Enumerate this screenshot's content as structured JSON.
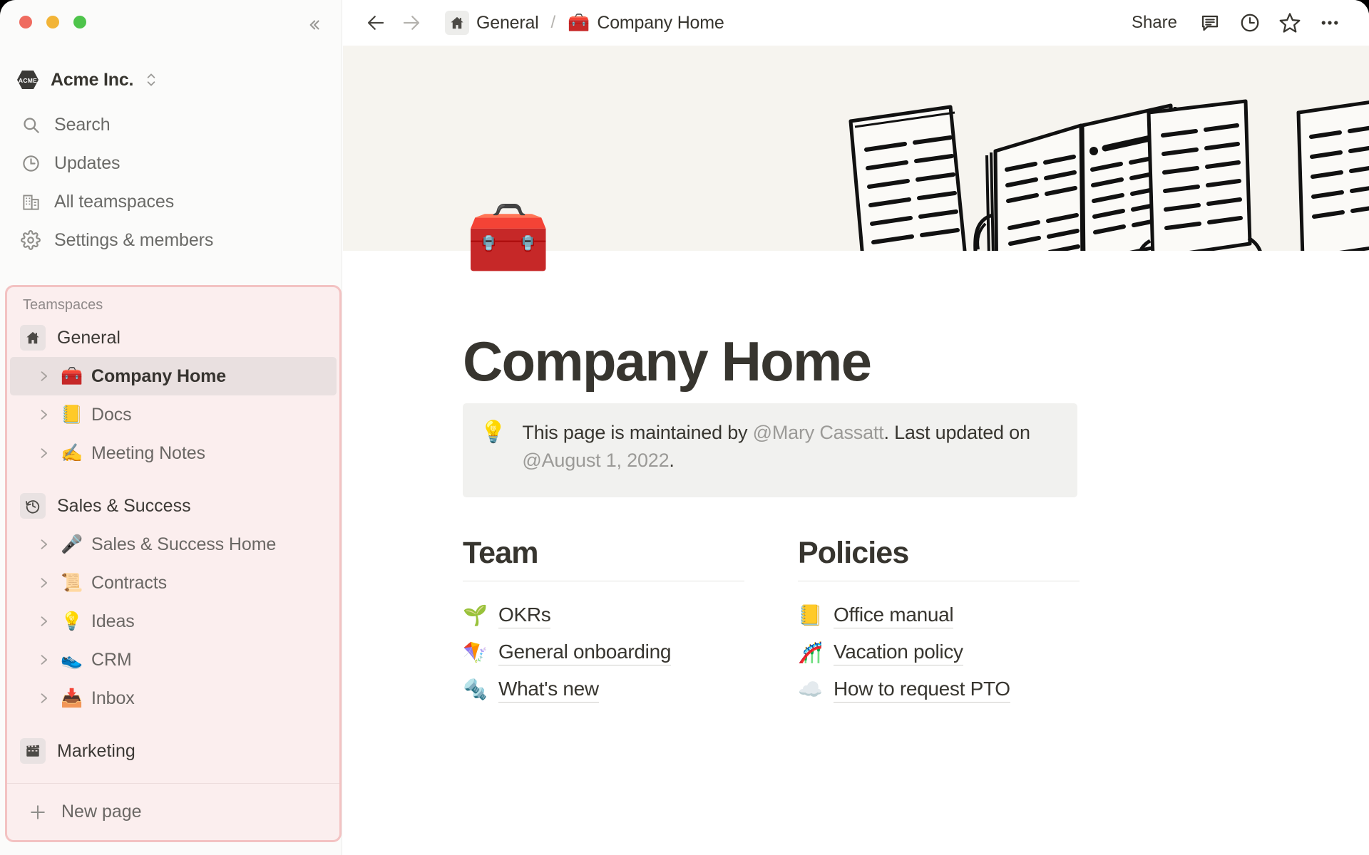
{
  "window": {
    "traffic_lights": [
      "close",
      "minimize",
      "maximize"
    ],
    "collapse_label": "«"
  },
  "sidebar": {
    "workspace": {
      "name": "Acme Inc.",
      "logo_text": "ACME",
      "switcher_icon": "chevron-up-down-icon"
    },
    "nav": [
      {
        "label": "Search",
        "icon": "search-icon"
      },
      {
        "label": "Updates",
        "icon": "clock-icon"
      },
      {
        "label": "All teamspaces",
        "icon": "building-icon"
      },
      {
        "label": "Settings & members",
        "icon": "gear-icon"
      }
    ],
    "teamspaces": {
      "title": "Teamspaces",
      "highlight_border_color": "#f3c2c2",
      "highlight_bg_color": "#fbeeee",
      "groups": [
        {
          "name": "General",
          "icon": "home-icon",
          "pages": [
            {
              "label": "Company Home",
              "emoji": "🧰",
              "selected": true
            },
            {
              "label": "Docs",
              "emoji": "📒",
              "selected": false
            },
            {
              "label": "Meeting Notes",
              "emoji": "✍️",
              "selected": false
            }
          ]
        },
        {
          "name": "Sales & Success",
          "icon": "history-icon",
          "pages": [
            {
              "label": "Sales & Success Home",
              "emoji": "🎤",
              "selected": false
            },
            {
              "label": "Contracts",
              "emoji": "📜",
              "selected": false
            },
            {
              "label": "Ideas",
              "emoji": "💡",
              "selected": false
            },
            {
              "label": "CRM",
              "emoji": "👟",
              "selected": false
            },
            {
              "label": "Inbox",
              "emoji": "📥",
              "selected": false
            }
          ]
        },
        {
          "name": "Marketing",
          "icon": "clapperboard-icon",
          "pages": []
        }
      ]
    },
    "new_page": {
      "label": "New page",
      "icon": "plus-icon"
    }
  },
  "topbar": {
    "back_icon": "arrow-left-icon",
    "forward_icon": "arrow-right-icon",
    "breadcrumb": {
      "separator": "/",
      "items": [
        {
          "label": "General",
          "icon": "home-icon",
          "emoji": ""
        },
        {
          "label": "Company Home",
          "icon": "",
          "emoji": "🧰"
        }
      ]
    },
    "share_label": "Share",
    "actions": [
      {
        "name": "comment-icon"
      },
      {
        "name": "history-icon"
      },
      {
        "name": "star-icon"
      },
      {
        "name": "more-icon"
      }
    ]
  },
  "page": {
    "cover_bg": "#f6f4ef",
    "icon_emoji": "🧰",
    "title": "Company Home",
    "callout": {
      "emoji": "💡",
      "prefix": "This page is maintained by ",
      "mention_user": "@Mary Cassatt",
      "middle": ". Last updated on ",
      "mention_date": "@August 1, 2022",
      "suffix": "."
    },
    "columns": [
      {
        "heading": "Team",
        "links": [
          {
            "label": "OKRs",
            "emoji": "🌱"
          },
          {
            "label": "General onboarding",
            "emoji": "🪁"
          },
          {
            "label": "What's new",
            "emoji": "🔩"
          }
        ]
      },
      {
        "heading": "Policies",
        "links": [
          {
            "label": "Office manual",
            "emoji": "📒"
          },
          {
            "label": "Vacation policy",
            "emoji": "🎢"
          },
          {
            "label": "How to request PTO",
            "emoji": "☁️"
          }
        ]
      }
    ]
  }
}
